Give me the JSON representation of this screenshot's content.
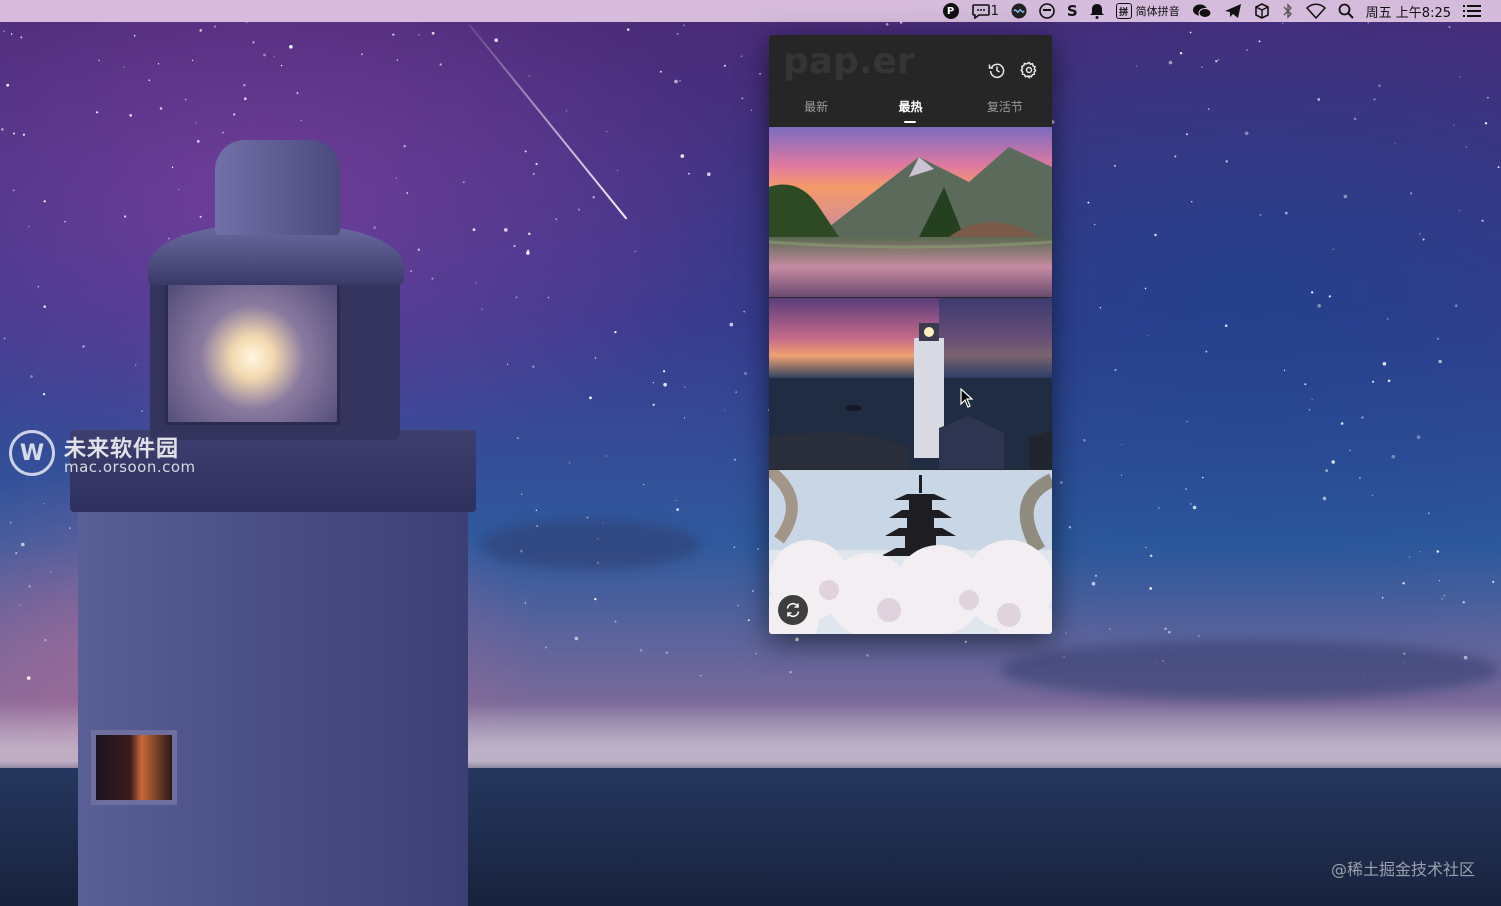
{
  "menubar": {
    "notification_count": "1",
    "input_method": "简体拼音",
    "ime_badge": "拼",
    "p_badge": "P",
    "s_icon": "S",
    "datetime": "周五 上午8:25",
    "icons": [
      "p-circle-icon",
      "comment-icon",
      "siri-icon",
      "fantastical-icon",
      "s-icon",
      "bell-icon",
      "ime-icon",
      "wechat-icon",
      "telegram-icon",
      "box-icon",
      "bluetooth-icon",
      "wifi-icon",
      "search-icon",
      "list-icon"
    ]
  },
  "app": {
    "logo": "pap.er",
    "tabs": [
      {
        "label": "最新",
        "active": false
      },
      {
        "label": "最热",
        "active": true
      },
      {
        "label": "复活节",
        "active": false
      }
    ],
    "wallpapers": [
      "mountain-lake-sunset",
      "lighthouse-night-sea",
      "pagoda-cherry-blossom"
    ]
  },
  "watermark": {
    "logo_letter": "W",
    "title": "未来软件园",
    "subtitle": "mac.orsoon.com",
    "corner": "@稀土掘金技术社区"
  },
  "colors": {
    "popover_bg": "#272727",
    "tab_active": "#ffffff",
    "tab_inactive": "#9a9a9a",
    "menubar_bg": "#e2c8e4"
  }
}
